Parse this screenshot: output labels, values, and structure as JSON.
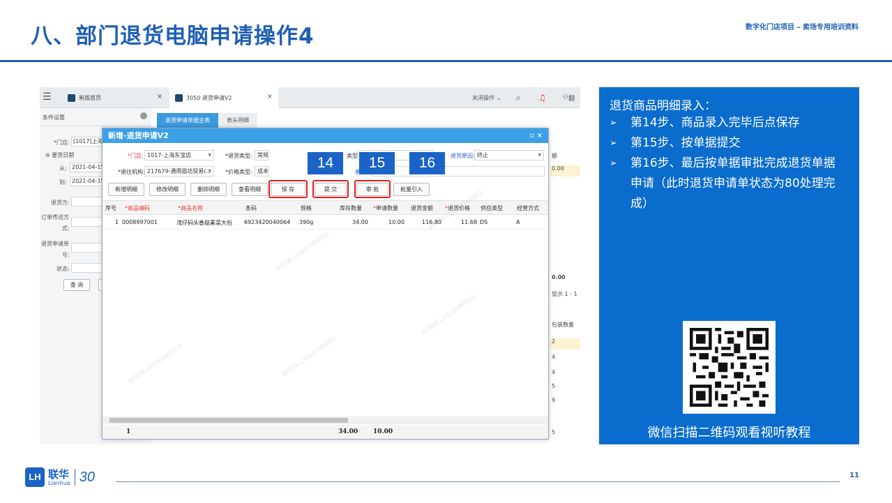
{
  "slide": {
    "title": "八、部门退货电脑申请操作4",
    "subtitle": "数字化门店项目 – 卖场专用培训资料",
    "page_number": "11"
  },
  "app": {
    "tabs": [
      {
        "label": "新版首页",
        "close": "×"
      },
      {
        "label": "3050 退货申请V2",
        "close": "×"
      }
    ],
    "close_ops": "关闭操作 ⌄",
    "user_fragment": "翻",
    "left_panel": {
      "header": "条件设置",
      "store_label": "*门店:",
      "store_value": "[1017]上海",
      "date_section": "要货日期",
      "from_label": "从:",
      "from_value": "2021-04-15",
      "to_label": "到:",
      "to_value": "2021-04-15",
      "returner_label": "退货方:",
      "order_send_label_1": "订单传送方",
      "order_send_label_2": "式:",
      "return_no_label_1": "退货申请单",
      "return_no_label_2": "号:",
      "status_label": "状态:",
      "query_button": "查 询"
    },
    "sub_tabs": [
      "退货申请单据主表",
      "表头明细"
    ],
    "bg_right": {
      "col_header": "额",
      "value_1": "0.00",
      "total": "0.00",
      "display": "显示 1 - 1",
      "pack_header": "包装数量",
      "rows": [
        "2",
        "4",
        "4",
        "5",
        "9"
      ],
      "last": "5"
    }
  },
  "dialog": {
    "title": "新增-退货申请V2",
    "controls": "▫  ×",
    "fields": {
      "store_label": "*门店:",
      "store_value": "1017-上海东宝店",
      "return_type_label": "*退货类型:",
      "return_type_value": "常规",
      "sub_type_label": "类型:",
      "reason_label": "退货原因:",
      "reason_value": "终止",
      "org_label": "*退往机构:",
      "org_value": "217679-通用眉坊贸易(...",
      "price_type_label": "*价格类型:",
      "price_type_value": "成本",
      "remark_label": "备注:"
    },
    "buttons": {
      "add_detail": "新增明细",
      "edit_detail": "修改明细",
      "delete_detail": "删除明细",
      "view_detail": "查看明细",
      "save": "保 存",
      "submit": "提 交",
      "approve": "审 批",
      "batch_import": "批量引入"
    },
    "steps": [
      "14",
      "15",
      "16"
    ],
    "columns": [
      "序号",
      "商品编码",
      "商品名称",
      "条码",
      "规格",
      "库存数量",
      "申请数量",
      "退货金额",
      "退货价格",
      "供应类型",
      "经营方式"
    ],
    "rows": [
      {
        "seq": "1",
        "code": "0008997001",
        "name": "湾仔码头香菇素菜大包",
        "barcode": "6923420040064",
        "spec": "390g",
        "stock": "34.00",
        "qty": "10.00",
        "amount": "116.80",
        "price": "11.68",
        "supply": "DS",
        "mode": "A"
      }
    ],
    "footer": {
      "count": "1",
      "stock_total": "34.00",
      "qty_total": "10.00"
    },
    "watermark": "赵晓娣-LHSHXM0003"
  },
  "info_panel": {
    "heading": "退货商品明细录入：",
    "bullet": "➢",
    "items": [
      "第14步、商品录入完毕后点保存",
      "第15步、按单据提交",
      "第16步、最后按单据审批完成退货单据申请（此时退货申请单状态为80处理完成）"
    ],
    "qr_caption": "微信扫描二维码观看视听教程"
  },
  "logo": {
    "mark": "LH",
    "cn": "联华",
    "en": "Lianhua",
    "anniversary": "30"
  },
  "colors": {
    "brand_blue": "#1f5fb4",
    "panel_blue": "#0a6ccc",
    "dialog_title": "#3ca0e6",
    "highlight_red": "#e02020"
  }
}
